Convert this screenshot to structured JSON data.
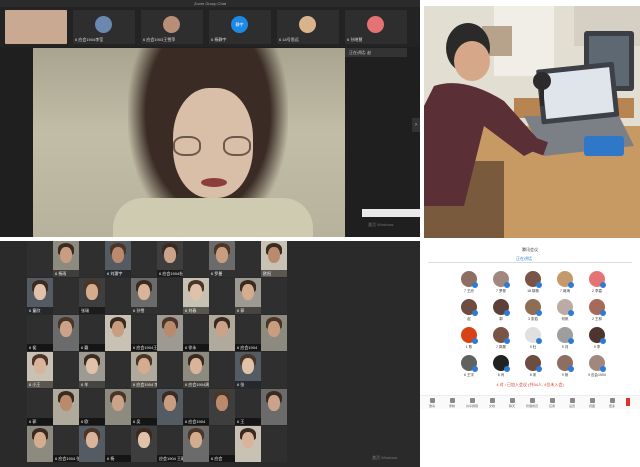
{
  "top_left": {
    "title": "Zoom Group Chat",
    "side_button": "正在讲话: 赵",
    "thumbnails": [
      {
        "label": "",
        "avatar": "photo",
        "color": "#caa68c"
      },
      {
        "label": "6 应会1904李莹",
        "avatar": "photo",
        "color": "#6a88b0"
      },
      {
        "label": "6 应会1903王雪萍",
        "avatar": "photo",
        "color": "#b88e77"
      },
      {
        "label": "6 杨静宇",
        "avatar": "text",
        "color": "#1e88e5",
        "text": "静宇"
      },
      {
        "label": "6 18号思远",
        "avatar": "photo",
        "color": "#d9b38c"
      },
      {
        "label": "6 孙晓慧",
        "avatar": "photo",
        "color": "#e57373"
      }
    ],
    "watermark": "激活 Windows"
  },
  "bottom_left": {
    "cells": [
      [
        "",
        "6 杨雨",
        "",
        "6 刘惠宇",
        "",
        "6 应会1904杜亚",
        "",
        "6 罗曼",
        "",
        "欧阳"
      ],
      [
        "6 童欣",
        "",
        "张瑞",
        "",
        "6 孙雪",
        "",
        "6 刘春",
        "",
        "6 郭",
        ""
      ],
      [
        "6 侯",
        "",
        "6 戴",
        "",
        "6 应会1904王朝",
        "",
        "6 徐永",
        "",
        "6 应会1904",
        ""
      ],
      [
        "6 小王",
        "",
        "6 牟",
        "",
        "6 应会1904 李",
        "",
        "6 应会1904周",
        "",
        "6 张",
        ""
      ],
      [
        "6 郭",
        "",
        "6 欧",
        "",
        "6 吴",
        "",
        "6 应会1904",
        "",
        "6 王",
        ""
      ],
      [
        "",
        "6 应会1904 张",
        "",
        "6 杨",
        "",
        "应会1904 王静",
        "",
        "6 应会",
        "",
        ""
      ]
    ],
    "watermark": "激活 Windows"
  },
  "participants": {
    "title": "腾讯会议",
    "tab_label": "正在讲话",
    "people": [
      {
        "name": "7 王欣",
        "color": "#8d6e63"
      },
      {
        "name": "7 罗曼",
        "color": "#a1887f"
      },
      {
        "name": "18 胡杨",
        "color": "#795548"
      },
      {
        "name": "7 蒋海",
        "color": "#c49a6c"
      },
      {
        "name": "2 李嘉",
        "color": "#e57373"
      },
      {
        "name": "赵",
        "color": "#6d4c41"
      },
      {
        "name": "郭",
        "color": "#5d4037"
      },
      {
        "name": "3 张若",
        "color": "#8e6e53"
      },
      {
        "name": "何帆",
        "color": "#bcaaa4"
      },
      {
        "name": "2 王林",
        "color": "#a66a5a"
      },
      {
        "name": "1 陈",
        "color": "#d84315"
      },
      {
        "name": "7 郭昊",
        "color": "#795548"
      },
      {
        "name": "9 杜",
        "color": "#e0e0e0"
      },
      {
        "name": "9 刘",
        "color": "#9e9e9e"
      },
      {
        "name": "9 李",
        "color": "#4e342e"
      },
      {
        "name": "6 王宇",
        "color": "#616161"
      },
      {
        "name": "8 闫",
        "color": "#212121"
      },
      {
        "name": "8 宋",
        "color": "#6d4c41"
      },
      {
        "name": "9 杨",
        "color": "#8d6e63"
      },
      {
        "name": "9 应会1904",
        "color": "#a1887f"
      }
    ],
    "hint": "4 对 / 已加入会议 (共54人, 4位未入会)",
    "toolbar": [
      "邀请",
      "录制",
      "共享屏幕",
      "文档",
      "聊天",
      "管理成员",
      "应用",
      "设置",
      "视图",
      "更多"
    ]
  }
}
